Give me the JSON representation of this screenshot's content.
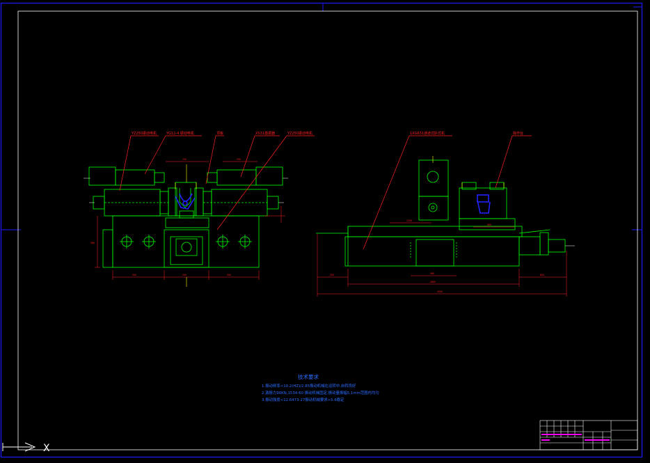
{
  "drawing": {
    "left_view": {
      "callouts": [
        "YZ250振动电机",
        "YG12-4 振动电机",
        "顶板",
        "XS31激振器",
        "YZ250振动电机"
      ]
    },
    "right_view": {
      "callouts": [
        "1XG631通道式卧式机",
        "操作台"
      ]
    },
    "notes": {
      "title": "技术要求",
      "lines": [
        "1.振动频率<10.2(HZ)/2.85振动机械在运转中,自转良好",
        "2.激振力90KN,1534-60 振动机械固定,振动量振幅5.1mm范围内均匀",
        "3.振动强度<12.6473-27振动机械要求>5.6稳定"
      ]
    }
  },
  "ucs": {
    "x_label": "X"
  },
  "colors": {
    "background": "#000000",
    "border": "#1a1aff",
    "geometry": "#00ff00",
    "annotation": "#ff2020",
    "dimension": "#ff2020",
    "highlight": "#2222ff",
    "center": "#ffff00",
    "frame": "#ffffff",
    "titleblock": "#ff00ff"
  }
}
